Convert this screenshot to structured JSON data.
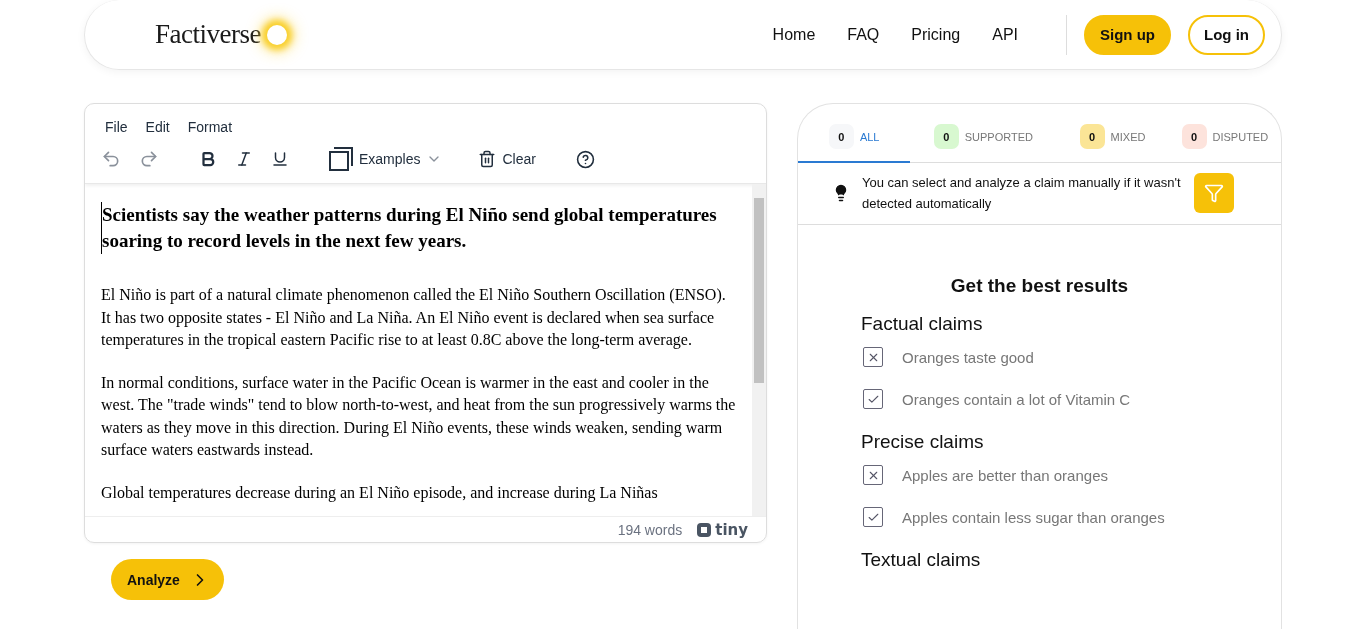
{
  "header": {
    "logo": "Factiverse",
    "nav": [
      "Home",
      "FAQ",
      "Pricing",
      "API"
    ],
    "signup": "Sign up",
    "login": "Log in"
  },
  "editor": {
    "menu": [
      "File",
      "Edit",
      "Format"
    ],
    "examples": "Examples",
    "clear": "Clear",
    "heading": "Scientists say the weather patterns during El Niño send global temperatures soaring to record levels in the next few years.",
    "paragraphs": [
      "El Niño is part of a natural climate phenomenon called the El Niño Southern Oscillation (ENSO). It has two opposite states - El Niño and La Niña. An El Niño event is declared when sea surface temperatures in the tropical eastern Pacific rise to at least 0.8C above the long-term average.",
      "In normal conditions, surface water in the Pacific Ocean is warmer in the east and cooler in the west. The \"trade winds\" tend to blow north-to-west, and heat from the sun progressively warms the waters as they move in this direction. During El Niño events, these winds weaken, sending warm surface waters eastwards instead.",
      "Global temperatures decrease during an El Niño episode, and increase during La Niñas"
    ],
    "word_count": "194 words",
    "brand": "tiny"
  },
  "analyze": "Analyze",
  "tabs": [
    {
      "count": "0",
      "label": "ALL",
      "color": "#f6f7f9",
      "selected": true
    },
    {
      "count": "0",
      "label": "SUPPORTED",
      "color": "#d8f8d0",
      "selected": false
    },
    {
      "count": "0",
      "label": "MIXED",
      "color": "#fbe596",
      "selected": false
    },
    {
      "count": "0",
      "label": "DISPUTED",
      "color": "#fde3dc",
      "selected": false
    }
  ],
  "tip": "You can select and analyze a claim manually if it wasn't detected automatically",
  "guide": {
    "title": "Get the best results",
    "sections": [
      {
        "title": "Factual claims",
        "items": [
          {
            "kind": "cross",
            "text": "Oranges taste good"
          },
          {
            "kind": "check",
            "text": "Oranges contain a lot of Vitamin C"
          }
        ]
      },
      {
        "title": "Precise claims",
        "items": [
          {
            "kind": "cross",
            "text": "Apples are better than oranges"
          },
          {
            "kind": "check",
            "text": "Apples contain less sugar than oranges"
          }
        ]
      },
      {
        "title": "Textual claims"
      }
    ]
  }
}
